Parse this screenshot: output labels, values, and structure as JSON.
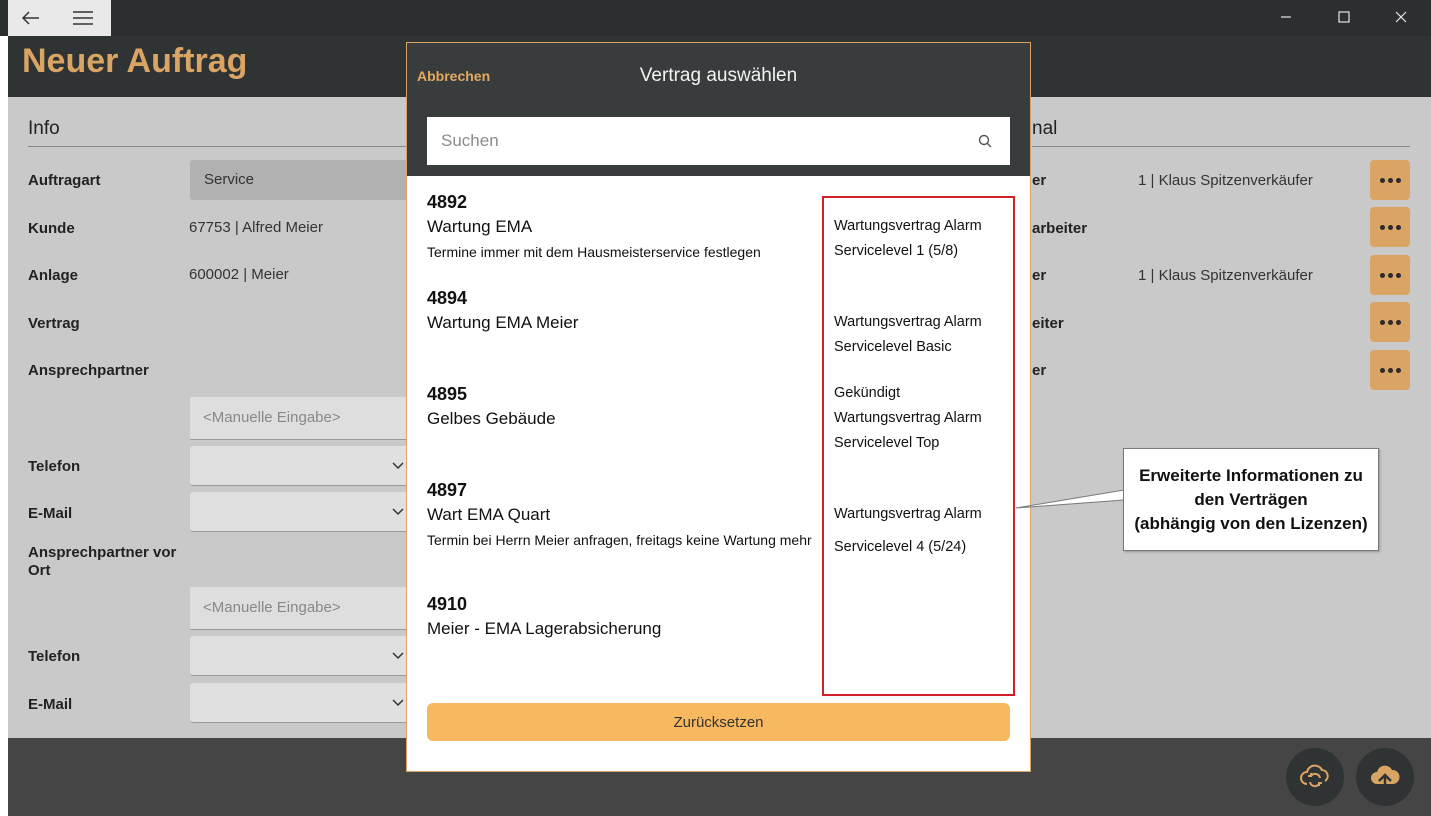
{
  "window": {
    "back_icon": "arrow-left-icon",
    "menu_icon": "hamburger-icon",
    "minimize_icon": "minimize-icon",
    "maximize_icon": "maximize-icon",
    "close_icon": "close-icon"
  },
  "app": {
    "title": "Neuer Auftrag",
    "accent_color": "#d9a464"
  },
  "info": {
    "section_title": "Info",
    "fields": {
      "auftragart_label": "Auftragart",
      "auftragart_value": "Service",
      "kunde_label": "Kunde",
      "kunde_value": "67753  |  Alfred Meier",
      "anlage_label": "Anlage",
      "anlage_value": "600002  |  Meier",
      "vertrag_label": "Vertrag",
      "ansprechpartner_label": "Ansprechpartner",
      "manual_placeholder_1": "<Manuelle Eingabe>",
      "telefon_label_1": "Telefon",
      "email_label_1": "E-Mail",
      "ansprechpartner_vor_ort_label": "Ansprechpartner vor Ort",
      "manual_placeholder_2": "<Manuelle Eingabe>",
      "telefon_label_2": "Telefon",
      "email_label_2": "E-Mail"
    }
  },
  "personal": {
    "section_title_fragment": "nal",
    "rows": [
      {
        "label_fragment": "er",
        "value": "1  |  Klaus Spitzenverkäufer"
      },
      {
        "label_fragment": "arbeiter",
        "value": ""
      },
      {
        "label_fragment": "er",
        "value": "1  |  Klaus Spitzenverkäufer"
      },
      {
        "label_fragment": "eiter",
        "value": ""
      },
      {
        "label_fragment": "er",
        "value": ""
      }
    ]
  },
  "modal": {
    "cancel_label": "Abbrechen",
    "title": "Vertrag auswählen",
    "search_placeholder": "Suchen",
    "reset_label": "Zurücksetzen",
    "contracts": [
      {
        "number": "4892",
        "name": "Wartung EMA",
        "note": "Termine immer mit dem Hausmeisterservice festlegen",
        "info": [
          "Wartungsvertrag Alarm",
          "Servicelevel 1 (5/8)"
        ]
      },
      {
        "number": "4894",
        "name": "Wartung EMA Meier",
        "note": "",
        "info": [
          "Wartungsvertrag Alarm",
          "Servicelevel Basic"
        ]
      },
      {
        "number": "4895",
        "name": "Gelbes Gebäude",
        "note": "",
        "info": [
          "Gekündigt",
          "Wartungsvertrag Alarm",
          "Servicelevel Top"
        ]
      },
      {
        "number": "4897",
        "name": "Wart EMA Quart",
        "note": "Termin bei Herrn Meier anfragen, freitags keine Wartung mehr",
        "info": [
          "Wartungsvertrag Alarm",
          "Servicelevel 4 (5/24)"
        ]
      },
      {
        "number": "4910",
        "name": "Meier - EMA Lagerabsicherung",
        "note": "",
        "info": []
      }
    ]
  },
  "callout": {
    "line1": "Erweiterte Informationen zu",
    "line2": "den Verträgen",
    "line3": "(abhängig von den Lizenzen)",
    "border_color": "#d21f2a"
  }
}
